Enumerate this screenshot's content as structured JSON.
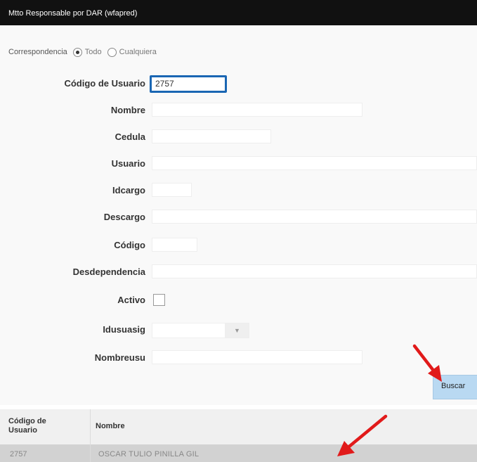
{
  "window": {
    "title": "Mtto Responsable por DAR (wfapred)"
  },
  "match": {
    "label": "Correspondencia",
    "options": [
      "Todo",
      "Cualquiera"
    ],
    "selected": "Todo"
  },
  "form": {
    "codigo_usuario": {
      "label": "Código de Usuario",
      "value": "2757"
    },
    "nombre": {
      "label": "Nombre",
      "value": ""
    },
    "cedula": {
      "label": "Cedula",
      "value": ""
    },
    "usuario": {
      "label": "Usuario",
      "value": ""
    },
    "idcargo": {
      "label": "Idcargo",
      "value": ""
    },
    "descargo": {
      "label": "Descargo",
      "value": ""
    },
    "codigo": {
      "label": "Código",
      "value": ""
    },
    "desdependencia": {
      "label": "Desdependencia",
      "value": ""
    },
    "activo": {
      "label": "Activo",
      "checked": false
    },
    "idusuasig": {
      "label": "Idusuasig",
      "value": "",
      "icon": "chevron-down-icon"
    },
    "nombreusu": {
      "label": "Nombreusu",
      "value": ""
    }
  },
  "buttons": {
    "search": "Buscar"
  },
  "results": {
    "columns": [
      "Código de Usuario",
      "Nombre"
    ],
    "rows": [
      {
        "codigo": "2757",
        "nombre": "OSCAR TULIO PINILLA GIL"
      }
    ]
  },
  "colors": {
    "titlebar": "#111111",
    "focus_border": "#1a66b3",
    "search_button": "#b9d9f2",
    "annotation_arrow": "#e11a1a",
    "selected_row": "#d2d2d2"
  }
}
